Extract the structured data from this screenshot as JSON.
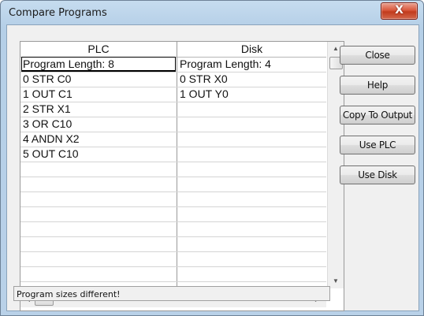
{
  "window": {
    "title": "Compare Programs",
    "close_glyph": "X"
  },
  "grid": {
    "columns": [
      "PLC",
      "Disk"
    ],
    "rows": [
      [
        "Program Length: 8",
        "Program Length: 4"
      ],
      [
        "0 STR C0",
        "0 STR X0"
      ],
      [
        "1 OUT C1",
        "1 OUT Y0"
      ],
      [
        "2 STR X1",
        ""
      ],
      [
        "3 OR C10",
        ""
      ],
      [
        "4 ANDN X2",
        ""
      ],
      [
        "5 OUT C10",
        ""
      ]
    ]
  },
  "buttons": {
    "close": "Close",
    "help": "Help",
    "copy_to_output": "Copy To Output",
    "use_plc": "Use PLC",
    "use_disk": "Use Disk"
  },
  "status": {
    "text": "Program sizes different!"
  }
}
